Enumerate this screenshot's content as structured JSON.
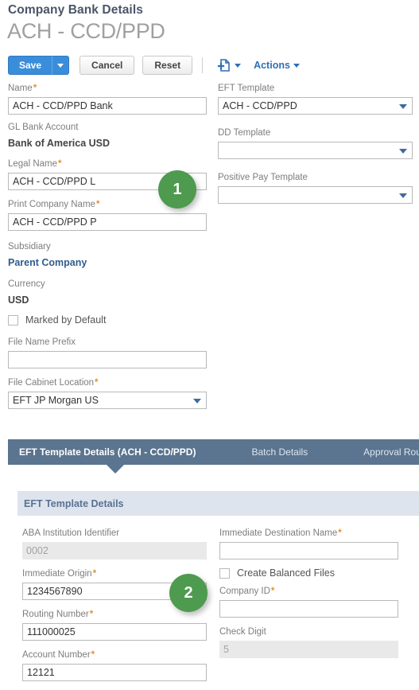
{
  "header": {
    "title": "Company Bank Details",
    "subtitle": "ACH - CCD/PPD"
  },
  "toolbar": {
    "save_label": "Save",
    "cancel_label": "Cancel",
    "reset_label": "Reset",
    "new_icon": "new-document-icon",
    "actions_label": "Actions"
  },
  "form": {
    "left": {
      "name_label": "Name",
      "name_value": "ACH - CCD/PPD Bank",
      "gl_bank_account_label": "GL Bank Account",
      "gl_bank_account_value": "Bank of America USD",
      "legal_name_label": "Legal Name",
      "legal_name_value": "ACH - CCD/PPD L",
      "print_company_name_label": "Print Company Name",
      "print_company_name_value": "ACH - CCD/PPD P",
      "subsidiary_label": "Subsidiary",
      "subsidiary_value": "Parent Company",
      "currency_label": "Currency",
      "currency_value": "USD",
      "marked_by_default_label": "Marked by Default",
      "marked_by_default_checked": false,
      "file_name_prefix_label": "File Name Prefix",
      "file_name_prefix_value": "",
      "file_cabinet_location_label": "File Cabinet Location",
      "file_cabinet_location_value": "EFT JP Morgan US"
    },
    "right": {
      "eft_template_label": "EFT Template",
      "eft_template_value": "ACH - CCD/PPD",
      "dd_template_label": "DD Template",
      "dd_template_value": "",
      "positive_pay_template_label": "Positive Pay Template",
      "positive_pay_template_value": ""
    }
  },
  "tabs": [
    {
      "label": "EFT Template Details (ACH - CCD/PPD)",
      "active": true
    },
    {
      "label": "Batch Details",
      "active": false
    },
    {
      "label": "Approval Routing",
      "active": false
    }
  ],
  "section": {
    "title": "EFT Template Details",
    "left": {
      "aba_label": "ABA Institution Identifier",
      "aba_value": "0002",
      "immediate_origin_label": "Immediate Origin",
      "immediate_origin_value": "1234567890",
      "routing_number_label": "Routing Number",
      "routing_number_value": "111000025",
      "account_number_label": "Account Number",
      "account_number_value": "12121"
    },
    "right": {
      "immediate_destination_name_label": "Immediate Destination Name",
      "immediate_destination_name_value": "",
      "create_balanced_files_label": "Create Balanced Files",
      "create_balanced_files_checked": false,
      "company_id_label": "Company ID",
      "company_id_value": "",
      "check_digit_label": "Check Digit",
      "check_digit_value": "5"
    }
  },
  "markers": [
    {
      "number": "1"
    },
    {
      "number": "2"
    }
  ],
  "colors": {
    "accent_blue": "#3a8ddb",
    "tab_bar": "#5b7490",
    "section_band": "#dde4ee",
    "marker_green": "#4e9a4e",
    "required_star": "#e2922b"
  },
  "required_marker": "*"
}
